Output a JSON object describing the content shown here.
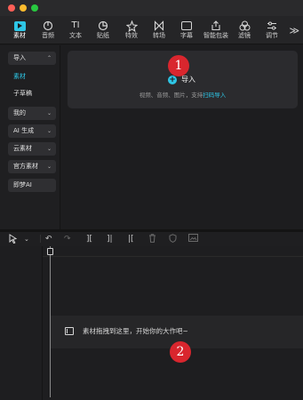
{
  "toolbar": {
    "tools": [
      {
        "label": "素材",
        "icon": "media-icon"
      },
      {
        "label": "音频",
        "icon": "audio-icon"
      },
      {
        "label": "文本",
        "icon": "text-icon"
      },
      {
        "label": "贴纸",
        "icon": "sticker-icon"
      },
      {
        "label": "特效",
        "icon": "effects-icon"
      },
      {
        "label": "转场",
        "icon": "transition-icon"
      },
      {
        "label": "字幕",
        "icon": "caption-icon"
      },
      {
        "label": "智能包装",
        "icon": "smart-package-icon"
      },
      {
        "label": "滤镜",
        "icon": "filter-icon"
      },
      {
        "label": "调节",
        "icon": "adjust-icon"
      }
    ],
    "more": "≫"
  },
  "sidebar": {
    "items": [
      {
        "label": "导入",
        "chevron": "⌃"
      },
      {
        "label": "素材",
        "chevron": ""
      },
      {
        "label": "子草稿",
        "chevron": ""
      },
      {
        "label": "我的",
        "chevron": "⌄"
      },
      {
        "label": "AI 生成",
        "chevron": "⌄"
      },
      {
        "label": "云素材",
        "chevron": "⌄"
      },
      {
        "label": "官方素材",
        "chevron": "⌄"
      },
      {
        "label": "即梦AI",
        "chevron": ""
      }
    ]
  },
  "import": {
    "label": "导入",
    "hint": "视频、音频、图片，支持",
    "link": "扫码导入"
  },
  "badges": {
    "one": "1",
    "two": "2"
  },
  "timeline": {
    "empty_hint": "素材拖拽到这里，开始你的大作吧~"
  },
  "colors": {
    "accent": "#2ec6e6",
    "badge": "#d9262e"
  }
}
